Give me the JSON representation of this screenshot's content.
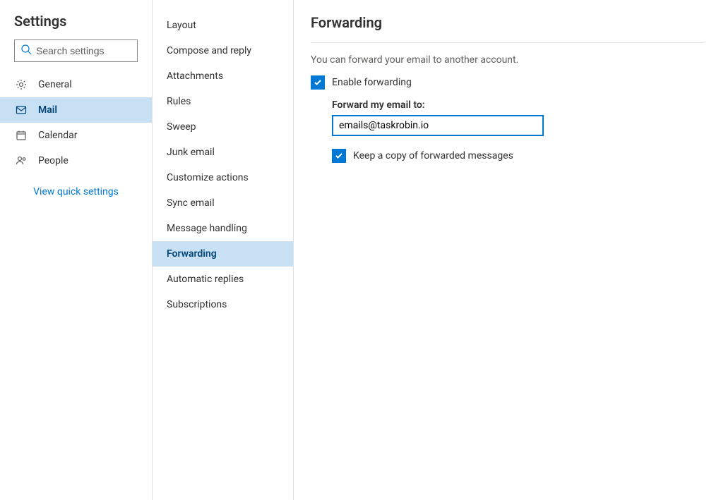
{
  "header": {
    "title": "Settings",
    "search_placeholder": "Search settings"
  },
  "nav1": {
    "items": [
      {
        "key": "general",
        "label": "General"
      },
      {
        "key": "mail",
        "label": "Mail"
      },
      {
        "key": "calendar",
        "label": "Calendar"
      },
      {
        "key": "people",
        "label": "People"
      }
    ],
    "selected": "mail",
    "quick_link": "View quick settings"
  },
  "nav2": {
    "items": [
      {
        "key": "layout",
        "label": "Layout"
      },
      {
        "key": "compose",
        "label": "Compose and reply"
      },
      {
        "key": "attachments",
        "label": "Attachments"
      },
      {
        "key": "rules",
        "label": "Rules"
      },
      {
        "key": "sweep",
        "label": "Sweep"
      },
      {
        "key": "junk",
        "label": "Junk email"
      },
      {
        "key": "customize",
        "label": "Customize actions"
      },
      {
        "key": "sync",
        "label": "Sync email"
      },
      {
        "key": "message-handling",
        "label": "Message handling"
      },
      {
        "key": "forwarding",
        "label": "Forwarding"
      },
      {
        "key": "auto-replies",
        "label": "Automatic replies"
      },
      {
        "key": "subscriptions",
        "label": "Subscriptions"
      }
    ],
    "selected": "forwarding"
  },
  "content": {
    "title": "Forwarding",
    "description": "You can forward your email to another account.",
    "enable_label": "Enable forwarding",
    "enable_checked": true,
    "forward_to_label": "Forward my email to:",
    "forward_to_value": "emails@taskrobin.io",
    "keep_copy_label": "Keep a copy of forwarded messages",
    "keep_copy_checked": true
  }
}
